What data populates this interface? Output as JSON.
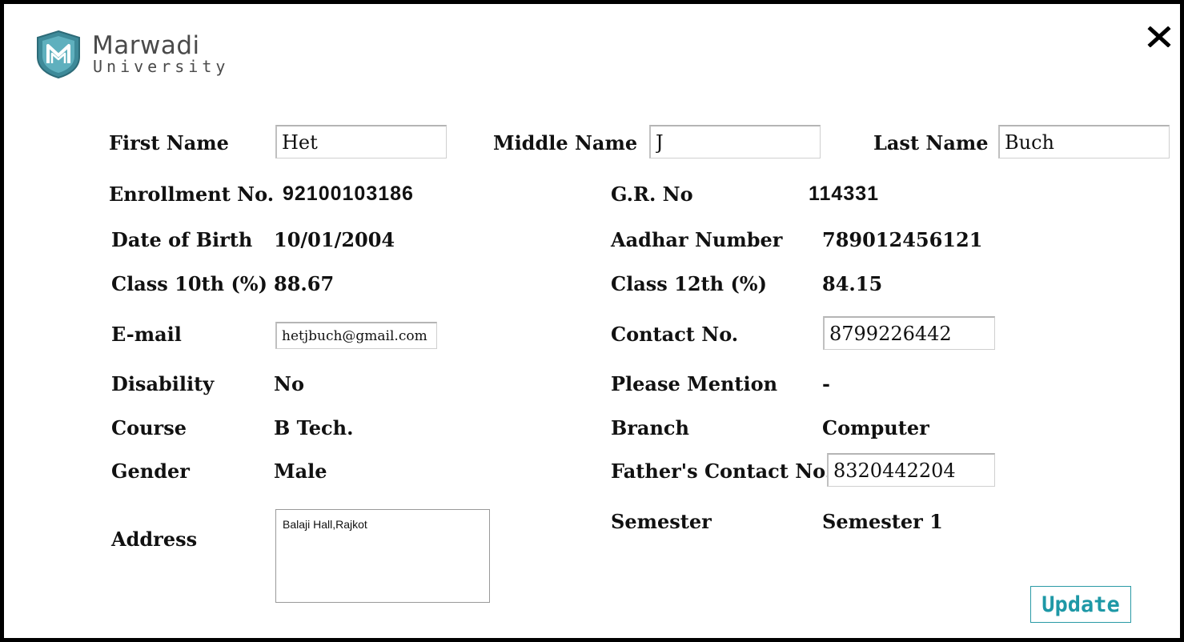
{
  "brand": {
    "name": "Marwadi",
    "sub": "University",
    "color": "#4a4a4a",
    "shield_color": "#3e8a99"
  },
  "icons": {
    "close": "close-icon",
    "logo": "shield-logo-icon"
  },
  "fields": {
    "first_name": {
      "label": "First Name",
      "value": "Het"
    },
    "middle_name": {
      "label": "Middle Name",
      "value": "J"
    },
    "last_name": {
      "label": "Last Name",
      "value": "Buch"
    },
    "enrollment": {
      "label": "Enrollment No.",
      "value": "92100103186"
    },
    "gr_no": {
      "label": "G.R. No",
      "value": "114331"
    },
    "dob": {
      "label": "Date of Birth",
      "value": "10/01/2004"
    },
    "aadhar": {
      "label": "Aadhar Number",
      "value": "789012456121"
    },
    "class10": {
      "label": "Class 10th (%)",
      "value": "88.67"
    },
    "class12": {
      "label": "Class 12th (%)",
      "value": "84.15"
    },
    "email": {
      "label": "E-mail",
      "value": "hetjbuch@gmail.com"
    },
    "contact": {
      "label": "Contact No.",
      "value": "8799226442"
    },
    "disability": {
      "label": "Disability",
      "value": "No"
    },
    "please_mention": {
      "label": "Please Mention",
      "value": "-"
    },
    "course": {
      "label": "Course",
      "value": "B Tech."
    },
    "branch": {
      "label": "Branch",
      "value": "Computer"
    },
    "gender": {
      "label": "Gender",
      "value": "Male"
    },
    "father_contact": {
      "label": "Father's Contact No.",
      "value": "8320442204"
    },
    "address": {
      "label": "Address",
      "value": "Balaji Hall,Rajkot"
    },
    "semester": {
      "label": "Semester",
      "value": "Semester 1"
    }
  },
  "actions": {
    "update_label": "Update",
    "accent": "#1e98a6"
  }
}
